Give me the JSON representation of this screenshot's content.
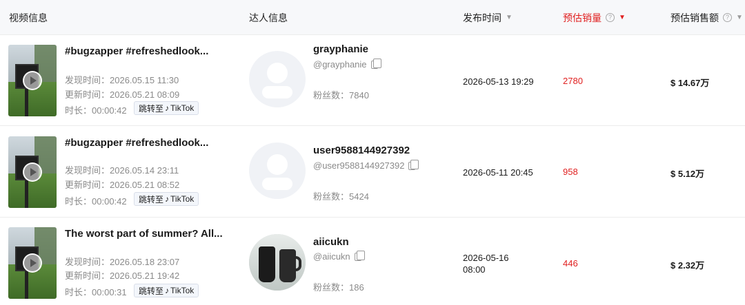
{
  "header": {
    "video_info": "视频信息",
    "creator_info": "达人信息",
    "publish_time": "发布时间",
    "est_sales": "预估销量",
    "est_revenue": "预估销售额"
  },
  "labels": {
    "discovered": "发现时间：",
    "updated": "更新时间：",
    "duration": "时长：",
    "fans": "粉丝数：",
    "goto": "跳转至",
    "tiktok": "TikTok"
  },
  "icons": {
    "play": "play-icon",
    "copy": "copy-icon",
    "help": "help-icon",
    "sort": "caret-down-icon",
    "tiktok": "tiktok-logo-icon"
  },
  "colors": {
    "accent": "#e02020",
    "header_bg": "#f7f8fa",
    "muted_text": "#8a8a8a"
  },
  "rows": [
    {
      "title": "#bugzapper #refreshedlook...",
      "discovered": "2026.05.15 11:30",
      "updated": "2026.05.21 08:09",
      "duration": "00:00:42",
      "creator_name": "grayphanie",
      "creator_handle": "@grayphanie",
      "fans": "7840",
      "publish_time": "2026-05-13 19:29",
      "publish_time_line2": "",
      "sales": "2780",
      "revenue": "$ 14.67万"
    },
    {
      "title": "#bugzapper #refreshedlook...",
      "discovered": "2026.05.14 23:11",
      "updated": "2026.05.21 08:52",
      "duration": "00:00:42",
      "creator_name": "user9588144927392",
      "creator_handle": "@user9588144927392",
      "fans": "5424",
      "publish_time": "2026-05-11 20:45",
      "publish_time_line2": "",
      "sales": "958",
      "revenue": "$ 5.12万"
    },
    {
      "title": "The worst part of summer? All...",
      "discovered": "2026.05.18 23:07",
      "updated": "2026.05.21 19:42",
      "duration": "00:00:31",
      "creator_name": "aiicukn",
      "creator_handle": "@aiicukn",
      "fans": "186",
      "publish_time": "2026-05-16",
      "publish_time_line2": "08:00",
      "sales": "446",
      "revenue": "$ 2.32万"
    }
  ]
}
